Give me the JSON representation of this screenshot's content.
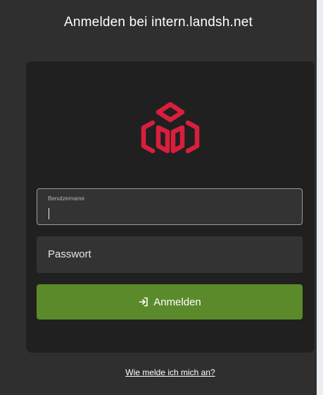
{
  "page": {
    "title": "Anmelden bei intern.landsh.net"
  },
  "login_form": {
    "username_label": "Benutzername",
    "username_value": "",
    "password_placeholder": "Passwort",
    "submit_label": "Anmelden"
  },
  "help": {
    "link_label": "Wie melde ich mich an?"
  },
  "icons": {
    "logo": "cube-logo-icon",
    "submit": "sign-in-icon"
  },
  "colors": {
    "background": "#2f2f2f",
    "card": "#202020",
    "field": "#333333",
    "accent_red": "#d91f3c",
    "button_green": "#5a8a2a"
  }
}
